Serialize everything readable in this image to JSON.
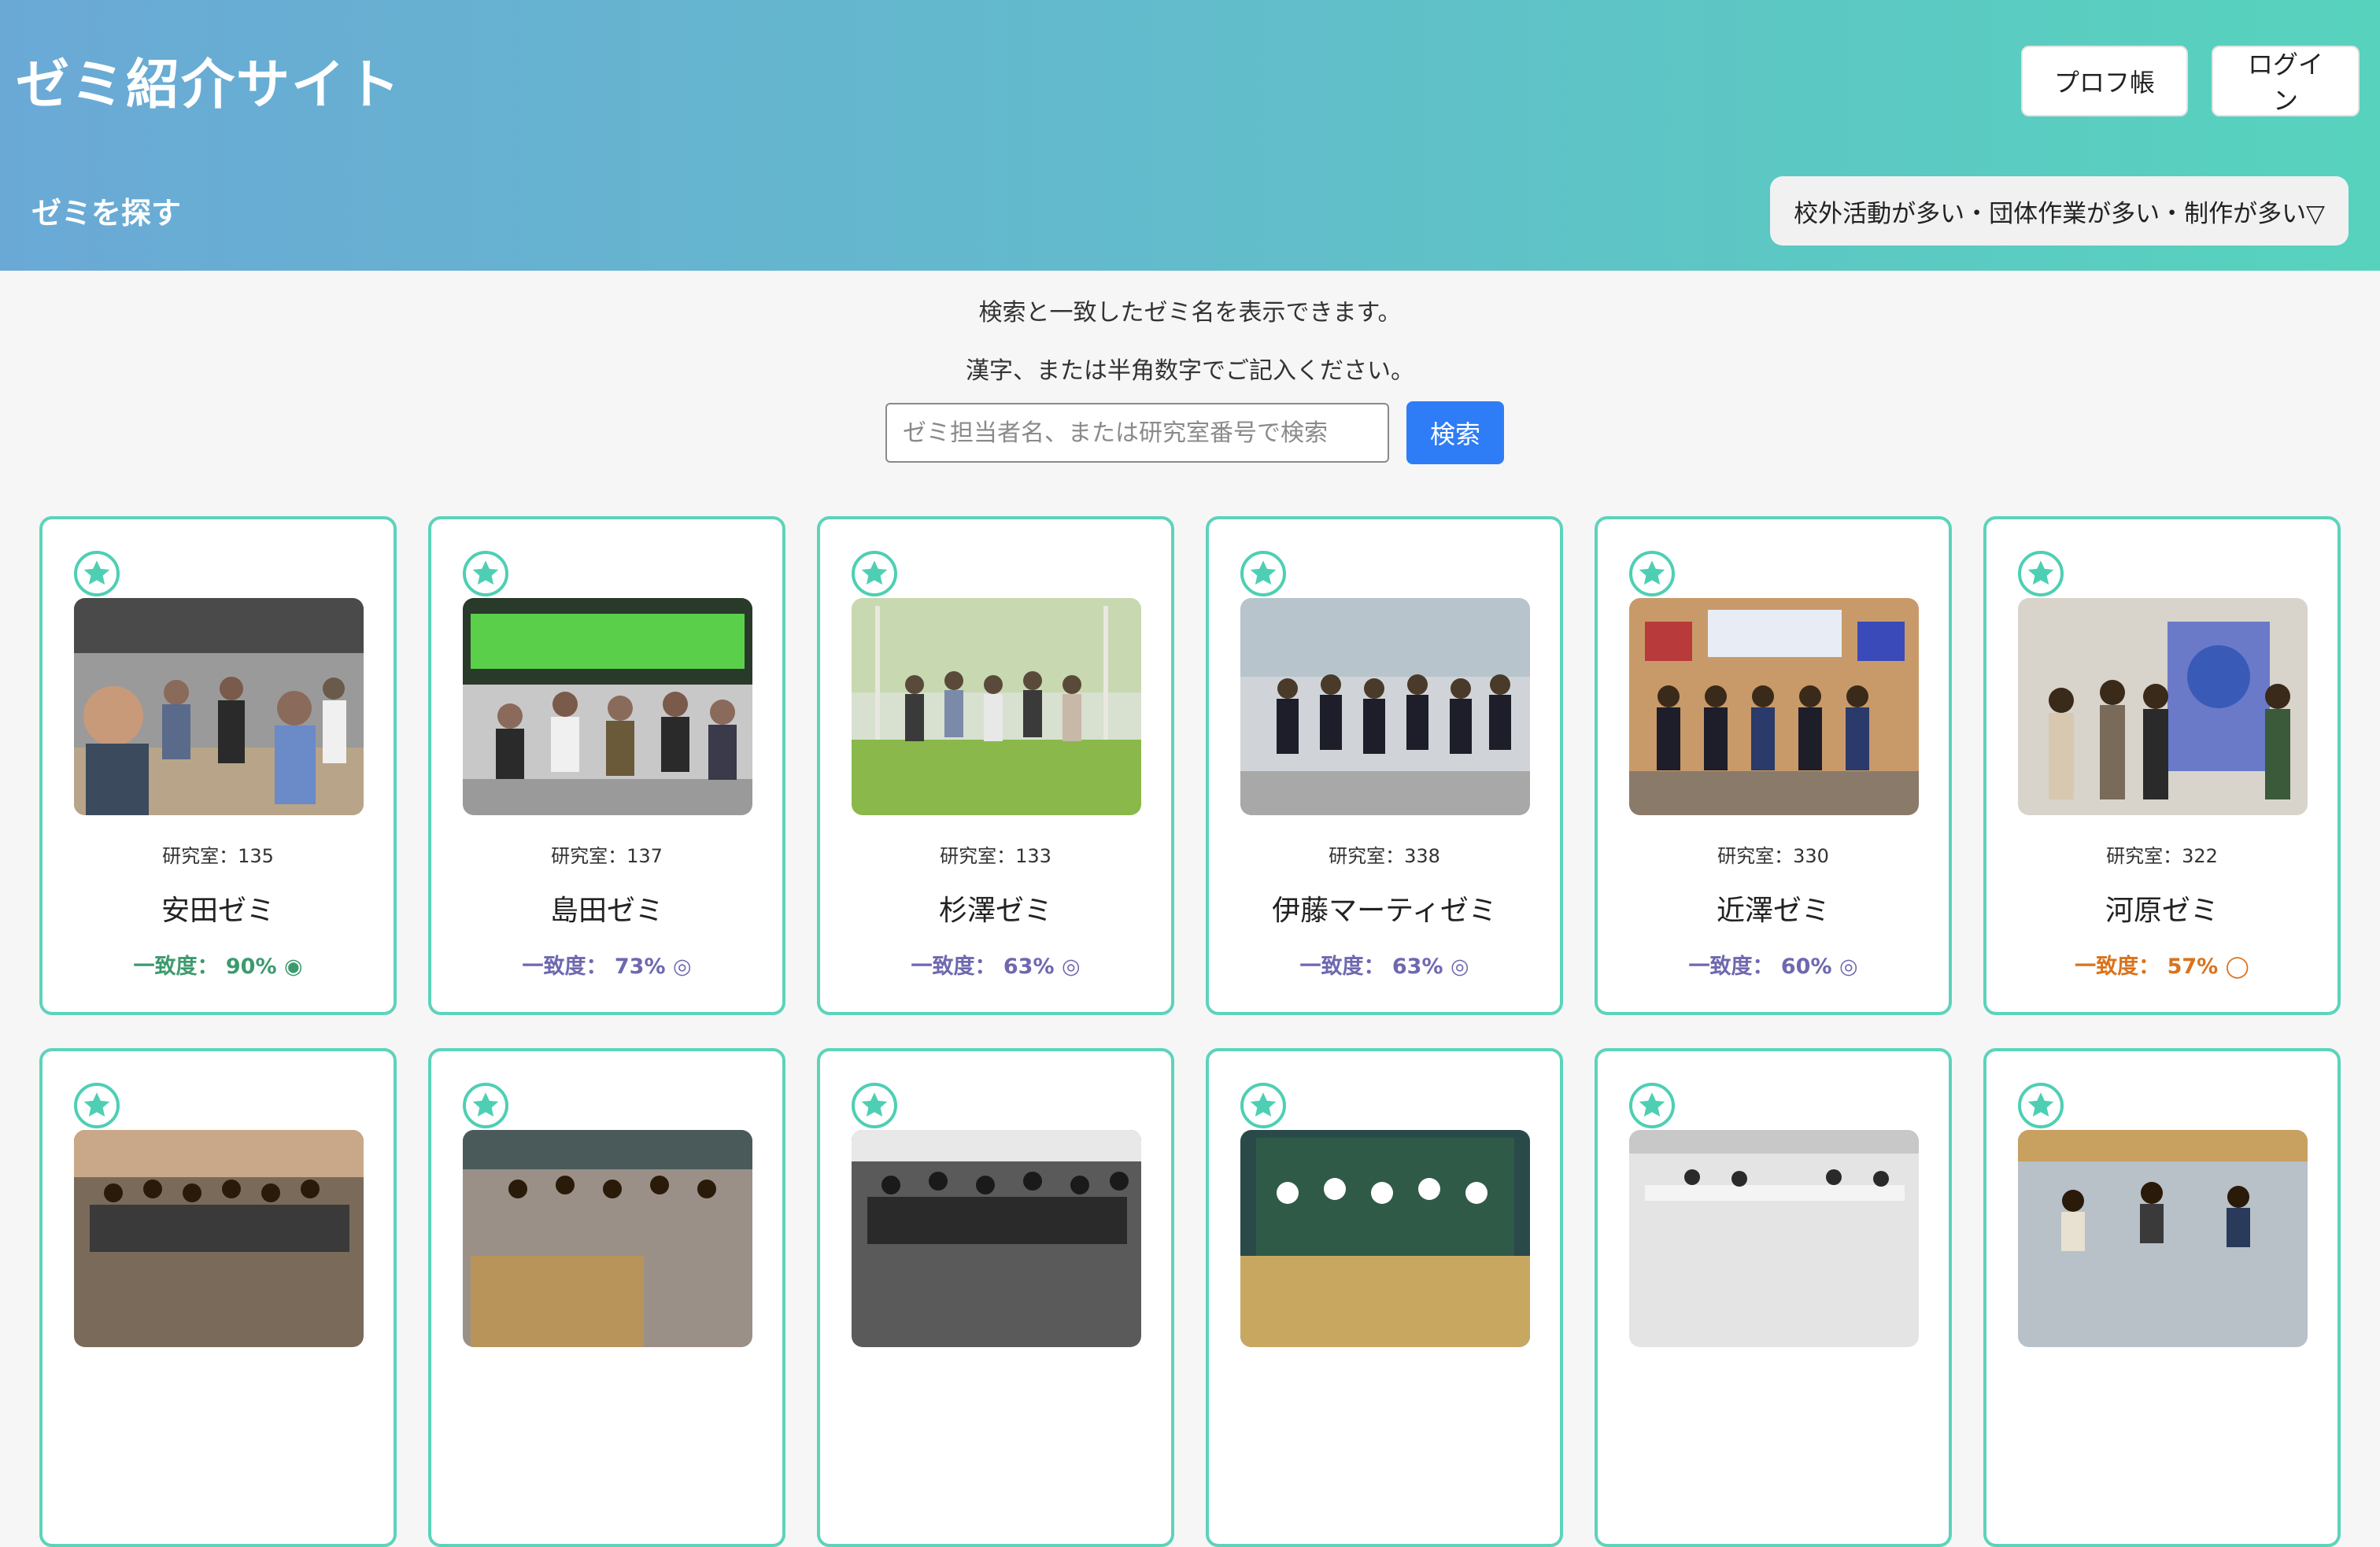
{
  "header": {
    "site_title": "ゼミ紹介サイト",
    "profile_button": "プロフ帳",
    "login_button": "ログイン",
    "section_title": "ゼミを探す",
    "filter_label": "校外活動が多い・団体作業が多い・制作が多い▽"
  },
  "search": {
    "info_line1": "検索と一致したゼミ名を表示できます。",
    "info_line2": "漢字、または半角数字でご記入ください。",
    "placeholder": "ゼミ担当者名、または研究室番号で検索",
    "button_label": "検索"
  },
  "cards": [
    {
      "lab": "研究室：135",
      "name": "安田ゼミ",
      "match_label": "一致度：",
      "match_value": "90%",
      "match_symbol": "◉",
      "match_color": "#3d9a6e"
    },
    {
      "lab": "研究室：137",
      "name": "島田ゼミ",
      "match_label": "一致度：",
      "match_value": "73%",
      "match_symbol": "◎",
      "match_color": "#6e68b0"
    },
    {
      "lab": "研究室：133",
      "name": "杉澤ゼミ",
      "match_label": "一致度：",
      "match_value": "63%",
      "match_symbol": "◎",
      "match_color": "#6e68b0"
    },
    {
      "lab": "研究室：338",
      "name": "伊藤マーティゼミ",
      "match_label": "一致度：",
      "match_value": "63%",
      "match_symbol": "◎",
      "match_color": "#6e68b0"
    },
    {
      "lab": "研究室：330",
      "name": "近澤ゼミ",
      "match_label": "一致度：",
      "match_value": "60%",
      "match_symbol": "◎",
      "match_color": "#6e68b0"
    },
    {
      "lab": "研究室：322",
      "name": "河原ゼミ",
      "match_label": "一致度：",
      "match_value": "57%",
      "match_symbol": "◯",
      "match_color": "#d9731c"
    }
  ],
  "colors": {
    "accent": "#5dd3bb",
    "button_blue": "#2f7df6"
  }
}
